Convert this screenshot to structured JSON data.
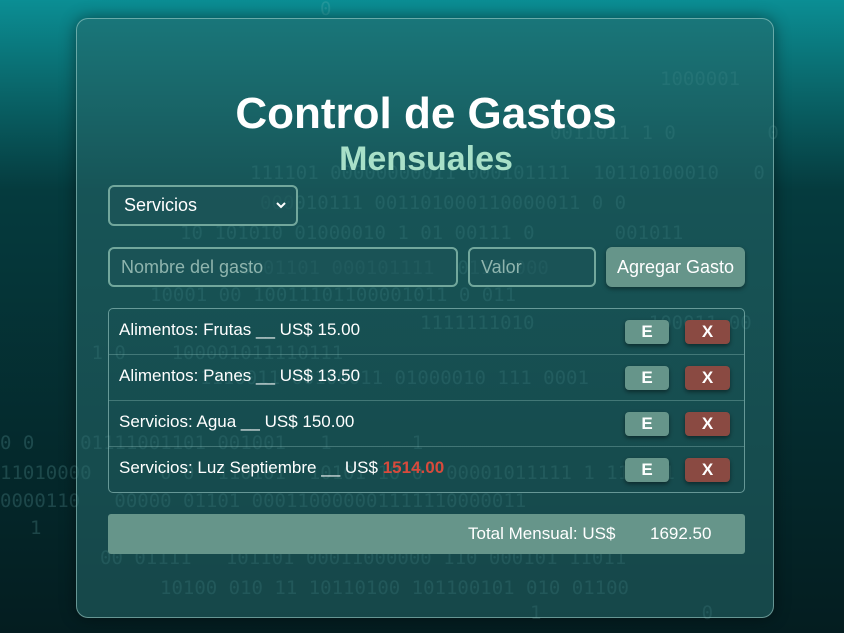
{
  "background": {
    "colors": {
      "top": "#0b8e94",
      "bottom": "#041d20"
    }
  },
  "header": {
    "title": "Control de Gastos",
    "subtitle": "Mensuales"
  },
  "form": {
    "category_select": {
      "selected": "Servicios"
    },
    "name_input": {
      "placeholder": "Nombre del gasto",
      "value": ""
    },
    "value_input": {
      "placeholder": "Valor",
      "value": ""
    },
    "add_button_label": "Agregar Gasto"
  },
  "expenses": [
    {
      "category": "Alimentos",
      "name": "Frutas",
      "separator": "__",
      "currency": "US$",
      "amount": "15.00",
      "highlight": false
    },
    {
      "category": "Alimentos",
      "name": "Panes",
      "separator": "__",
      "currency": "US$",
      "amount": "13.50",
      "highlight": false
    },
    {
      "category": "Servicios",
      "name": "Agua",
      "separator": "__",
      "currency": "US$",
      "amount": "150.00",
      "highlight": false
    },
    {
      "category": "Servicios",
      "name": "Luz Septiembre",
      "separator": "__",
      "currency": "US$",
      "amount": "1514.00",
      "highlight": true
    }
  ],
  "row_actions": {
    "edit_label": "E",
    "delete_label": "X"
  },
  "total": {
    "label": "Total Mensual: US$",
    "value": "1692.50"
  },
  "colors": {
    "accent": "#66958a",
    "delete": "#8a4a42",
    "highlight_amount": "#d84a3c",
    "subtitle": "#a8e0c8"
  }
}
